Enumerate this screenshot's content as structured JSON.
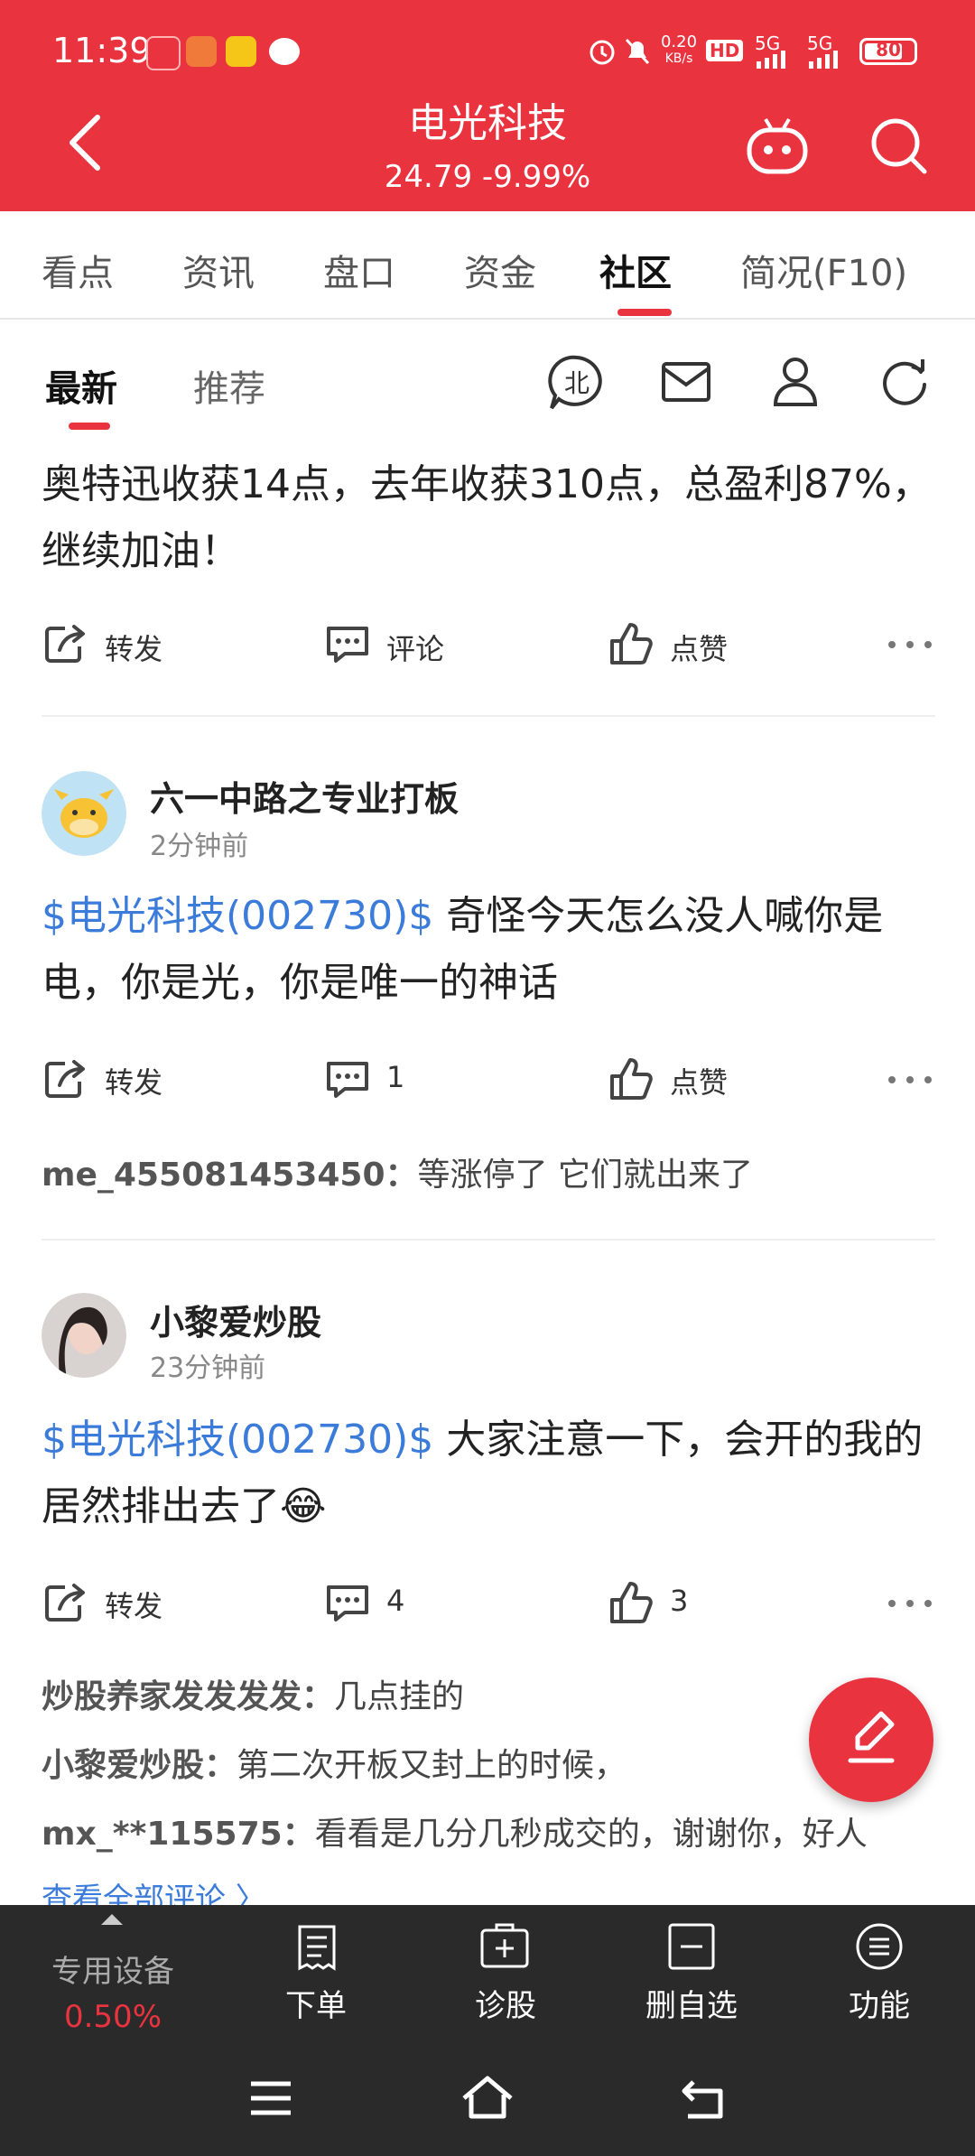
{
  "status": {
    "time": "11:39",
    "net_speed_top": "0.20",
    "net_speed_unit": "KB/s",
    "hd": "HD",
    "sig1": "5G",
    "sig2": "5G",
    "battery": "80"
  },
  "header": {
    "title": "电光科技",
    "price": "24.79 -9.99%"
  },
  "tabs": [
    "看点",
    "资讯",
    "盘口",
    "资金",
    "社区",
    "简况(F10)"
  ],
  "active_tab": "社区",
  "subtabs": [
    "最新",
    "推荐"
  ],
  "active_subtab": "最新",
  "posts": [
    {
      "text": "奥特迅收获14点，去年收获310点，总盈利87%，继续加油！",
      "actions": {
        "forward": "转发",
        "comment": "评论",
        "like": "点赞"
      }
    },
    {
      "user": "六一中路之专业打板",
      "time": "2分钟前",
      "stock": "$电光科技(002730)$",
      "text": " 奇怪今天怎么没人喊你是电，你是光，你是唯一的神话",
      "actions": {
        "forward": "转发",
        "comment": "1",
        "like": "点赞"
      },
      "comments": [
        {
          "user": "me_455081453450：",
          "text": "等涨停了 它们就出来了"
        }
      ]
    },
    {
      "user": "小黎爱炒股",
      "time": "23分钟前",
      "stock": "$电光科技(002730)$",
      "text": " 大家注意一下，会开的我的居然排出去了😂",
      "actions": {
        "forward": "转发",
        "comment": "4",
        "like": "3"
      },
      "comments": [
        {
          "user": "炒股养家发发发发：",
          "text": "几点挂的"
        },
        {
          "user": "小黎爱炒股：",
          "text": "第二次开板又封上的时候，"
        },
        {
          "user": "mx_**115575：",
          "text": "看看是几分几秒成交的，谢谢你，好人"
        }
      ],
      "view_all": "查看全部评论 〉"
    }
  ],
  "bottom": {
    "device_label": "专用设备",
    "device_value": "0.50%",
    "items": [
      "下单",
      "诊股",
      "删自选",
      "功能"
    ]
  },
  "colors": {
    "brand_red": "#e9333f",
    "link_blue": "#3b7bd9"
  }
}
